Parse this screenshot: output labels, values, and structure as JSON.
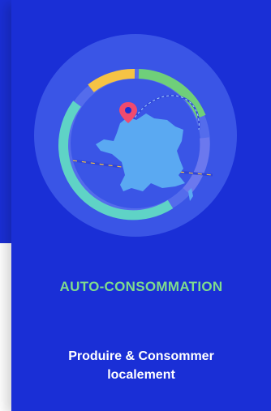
{
  "card": {
    "title": "AUTO-CONSOMMATION",
    "subtitle_line1": "Produire & Consommer",
    "subtitle_line2": "localement",
    "icon": "france-map-location-icon"
  },
  "colors": {
    "background_blue": "#1a2fd6",
    "title_green": "#7fdc8c",
    "ring_teal": "#5fd3c6",
    "ring_yellow": "#f6c344",
    "ring_green": "#6fcf7a",
    "map_blue": "#5aa9f2",
    "pin_pink": "#f04a6e"
  }
}
